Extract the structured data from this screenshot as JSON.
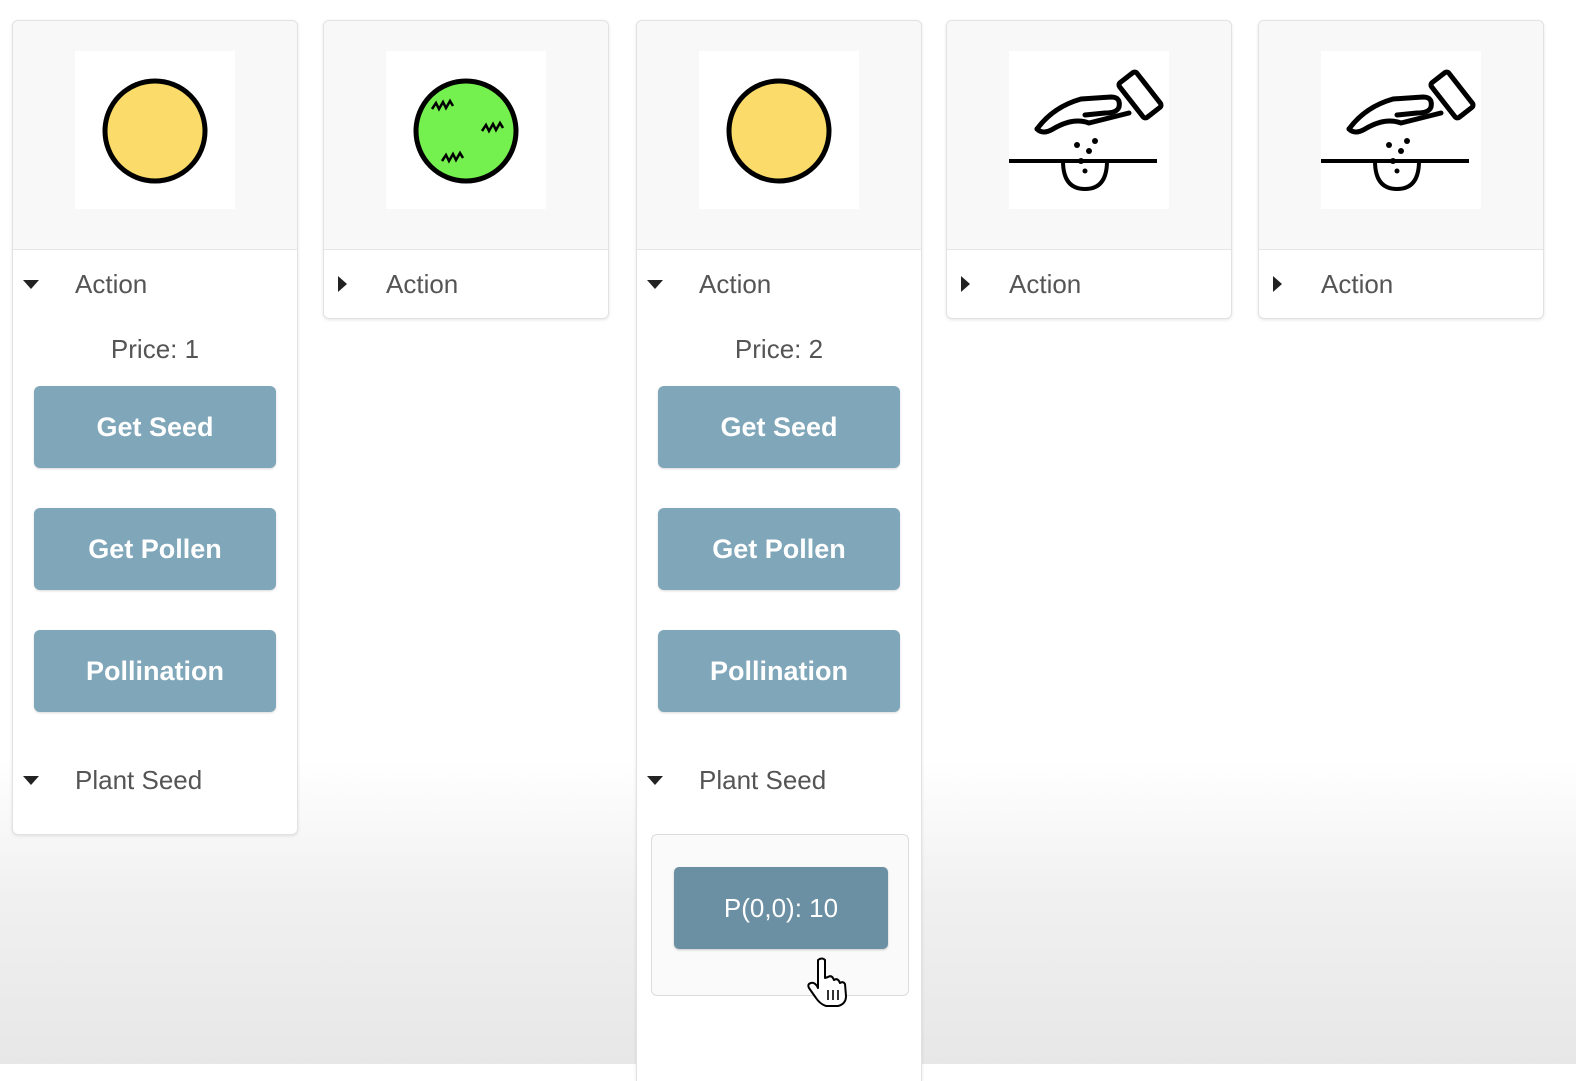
{
  "cards": [
    {
      "icon": "yellow-seed-icon",
      "action_label": "Action",
      "expanded": true,
      "price_text": "Price: 1",
      "buttons": [
        "Get Seed",
        "Get Pollen",
        "Pollination"
      ],
      "plant_label": "Plant Seed"
    },
    {
      "icon": "green-pollen-icon",
      "action_label": "Action",
      "expanded": false
    },
    {
      "icon": "yellow-seed-icon",
      "action_label": "Action",
      "expanded": true,
      "price_text": "Price: 2",
      "buttons": [
        "Get Seed",
        "Get Pollen",
        "Pollination"
      ],
      "plant_label": "Plant Seed",
      "plot_button": "P(0,0): 10"
    },
    {
      "icon": "hand-planting-seed-icon",
      "action_label": "Action",
      "expanded": false
    },
    {
      "icon": "hand-planting-seed-icon",
      "action_label": "Action",
      "expanded": false
    }
  ],
  "colors": {
    "button": "#7fa6b9",
    "button_hover": "#6b90a3",
    "seed_yellow": "#fbdc6a",
    "pollen_green": "#74f04f"
  },
  "cursor_icon": "hand-pointer-icon"
}
